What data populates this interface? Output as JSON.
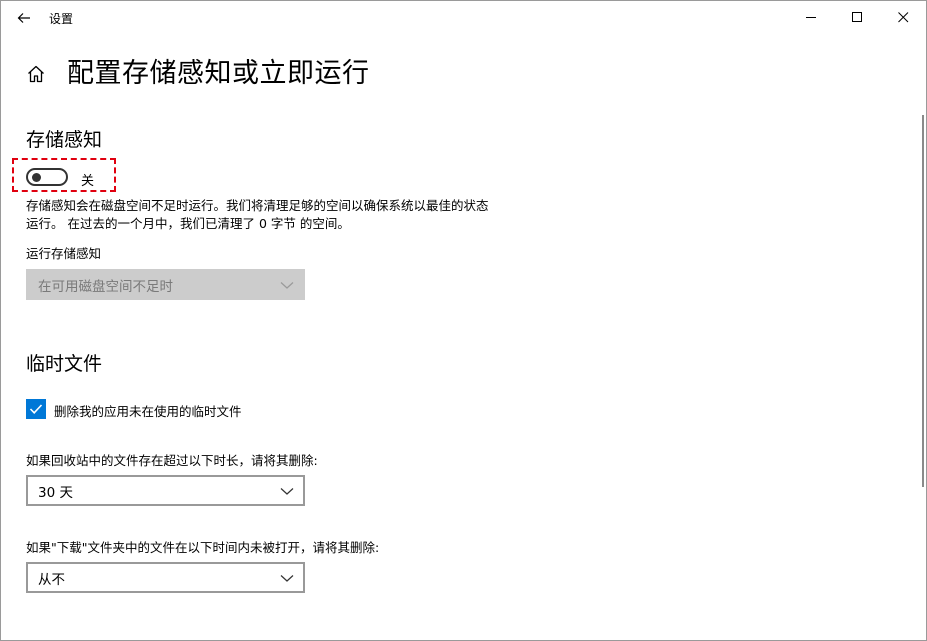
{
  "window": {
    "app_title": "设置",
    "back_icon": "back-arrow-icon",
    "controls": [
      "minimize-icon",
      "maximize-icon",
      "close-icon"
    ]
  },
  "header": {
    "home_icon": "home-icon",
    "title": "配置存储感知或立即运行"
  },
  "storage_sense": {
    "section_title": "存储感知",
    "toggle_state": "关",
    "toggle_on": false,
    "description": "存储感知会在磁盘空间不足时运行。我们将清理足够的空间以确保系统以最佳的状态运行。 在过去的一个月中，我们已清理了 0 字节 的空间。",
    "run_label": "运行存储感知",
    "run_dropdown_value": "在可用磁盘空间不足时",
    "run_dropdown_disabled": true
  },
  "temp_files": {
    "section_title": "临时文件",
    "checkbox_label": "删除我的应用未在使用的临时文件",
    "checkbox_checked": true,
    "recycle_label": "如果回收站中的文件存在超过以下时长，请将其删除:",
    "recycle_value": "30 天",
    "downloads_label": "如果\"下载\"文件夹中的文件在以下时间内未被打开，请将其删除:",
    "downloads_value": "从不"
  },
  "colors": {
    "accent": "#0078d7",
    "highlight": "#e0000f",
    "disabled_bg": "#cccccc"
  }
}
